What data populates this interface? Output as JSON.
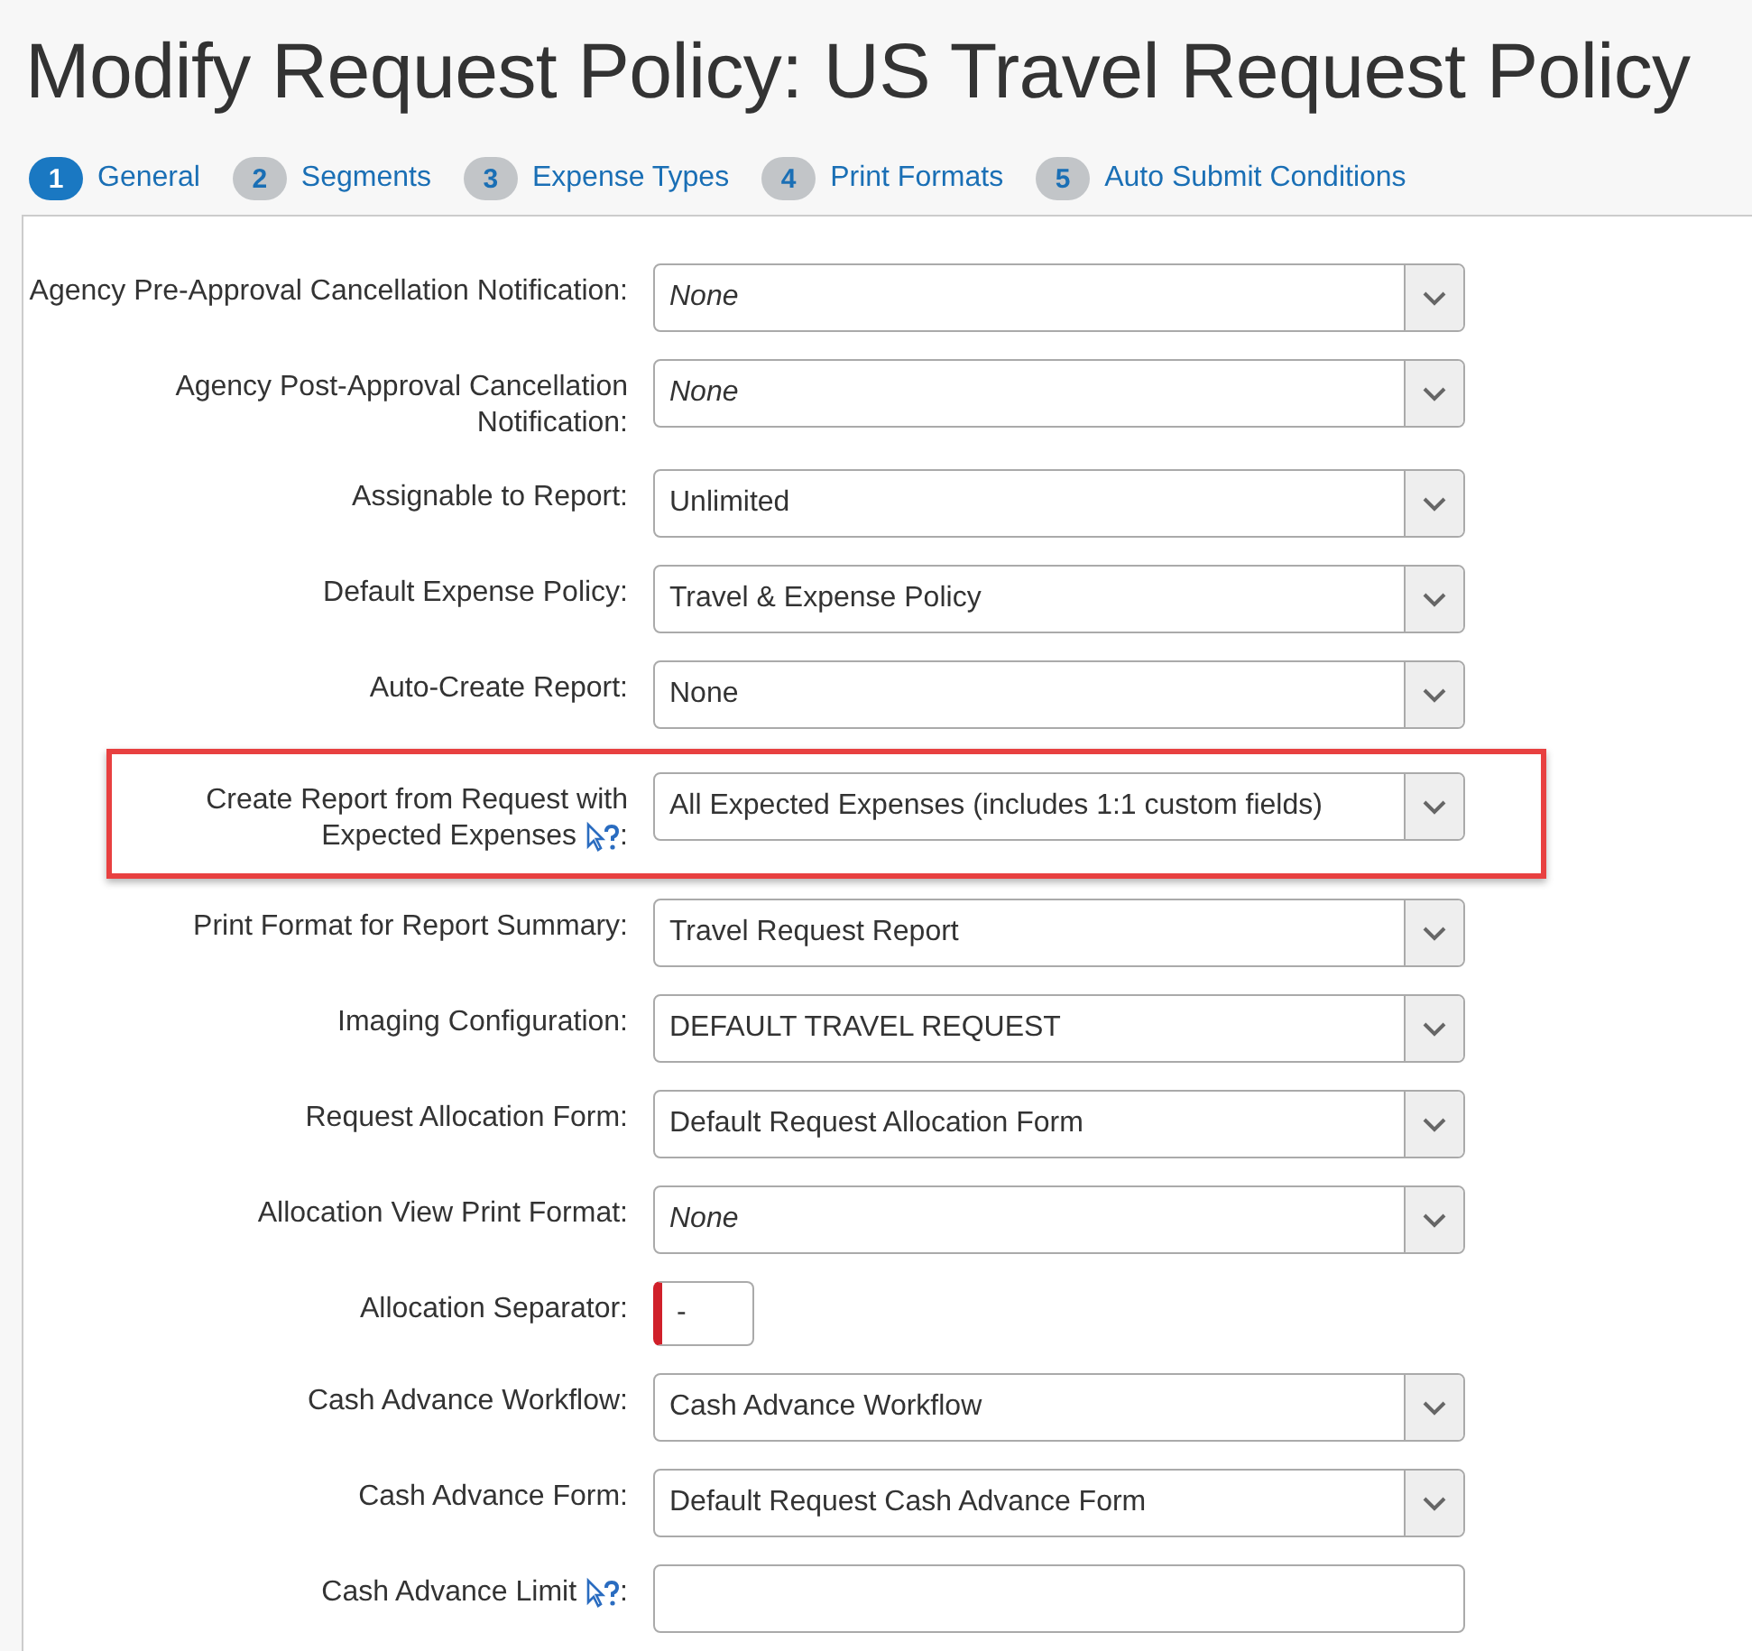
{
  "title": "Modify Request Policy: US Travel Request Policy",
  "tabs": [
    {
      "number": "1",
      "label": "General",
      "selected": true
    },
    {
      "number": "2",
      "label": "Segments",
      "selected": false
    },
    {
      "number": "3",
      "label": "Expense Types",
      "selected": false
    },
    {
      "number": "4",
      "label": "Print Formats",
      "selected": false
    },
    {
      "number": "5",
      "label": "Auto Submit Conditions",
      "selected": false
    }
  ],
  "fields": [
    {
      "label": "Agency Pre-Approval Cancellation Notification:",
      "kind": "select",
      "value": "None",
      "italic": true,
      "help": false,
      "highlighted": false
    },
    {
      "label": "Agency Post-Approval Cancellation Notification:",
      "kind": "select",
      "value": "None",
      "italic": true,
      "help": false,
      "highlighted": false
    },
    {
      "label": "Assignable to Report:",
      "kind": "select",
      "value": "Unlimited",
      "italic": false,
      "help": false,
      "highlighted": false
    },
    {
      "label": "Default Expense Policy:",
      "kind": "select",
      "value": "Travel & Expense Policy",
      "italic": false,
      "help": false,
      "highlighted": false
    },
    {
      "label": "Auto-Create Report:",
      "kind": "select",
      "value": "None",
      "italic": false,
      "help": false,
      "highlighted": false
    },
    {
      "label": "Create Report from Request with Expected Expenses",
      "kind": "select",
      "value": "All Expected Expenses (includes 1:1 custom fields)",
      "italic": false,
      "help": true,
      "suffix": ":",
      "highlighted": true
    },
    {
      "label": "Print Format for Report Summary:",
      "kind": "select",
      "value": "Travel Request Report",
      "italic": false,
      "help": false,
      "highlighted": false
    },
    {
      "label": "Imaging Configuration:",
      "kind": "select",
      "value": "DEFAULT TRAVEL REQUEST",
      "italic": false,
      "help": false,
      "highlighted": false
    },
    {
      "label": "Request Allocation Form:",
      "kind": "select",
      "value": "Default Request Allocation Form",
      "italic": false,
      "help": false,
      "highlighted": false
    },
    {
      "label": "Allocation View Print Format:",
      "kind": "select",
      "value": "None",
      "italic": true,
      "help": false,
      "highlighted": false
    },
    {
      "label": "Allocation Separator:",
      "kind": "short",
      "value": "-",
      "required": true,
      "help": false,
      "highlighted": false
    },
    {
      "label": "Cash Advance Workflow:",
      "kind": "select",
      "value": "Cash Advance Workflow",
      "italic": false,
      "help": false,
      "highlighted": false
    },
    {
      "label": "Cash Advance Form:",
      "kind": "select",
      "value": "Default Request Cash Advance Form",
      "italic": false,
      "help": false,
      "highlighted": false
    },
    {
      "label": "Cash Advance Limit",
      "kind": "text",
      "help": true,
      "suffix": ":",
      "highlighted": false
    }
  ]
}
